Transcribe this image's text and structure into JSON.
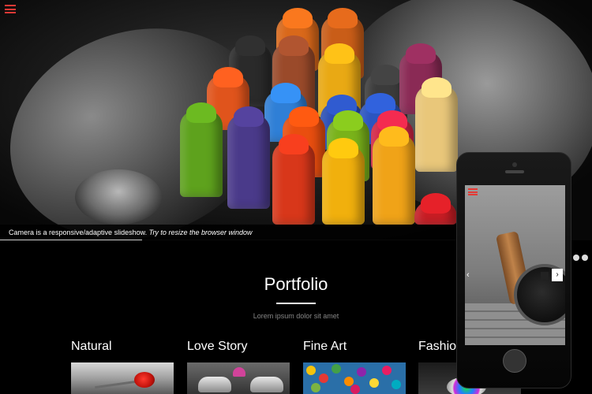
{
  "hero": {
    "caption_main": "Camera is a responsive/adaptive slideshow.",
    "caption_em": "Try to resize the browser window",
    "progress": 0.31
  },
  "portfolio": {
    "title": "Portfolio",
    "subtitle": "Lorem ipsum dolor sit amet",
    "categories": [
      {
        "label": "Natural"
      },
      {
        "label": "Love Story"
      },
      {
        "label": "Fine Art"
      },
      {
        "label": "Fashion"
      }
    ]
  },
  "colors": {
    "accent": "#e53935",
    "background": "#000000"
  },
  "icons": {
    "menu": "hamburger-menu-icon",
    "prev": "chevron-left-icon",
    "next": "chevron-right-icon",
    "pause": "pause-icon"
  }
}
